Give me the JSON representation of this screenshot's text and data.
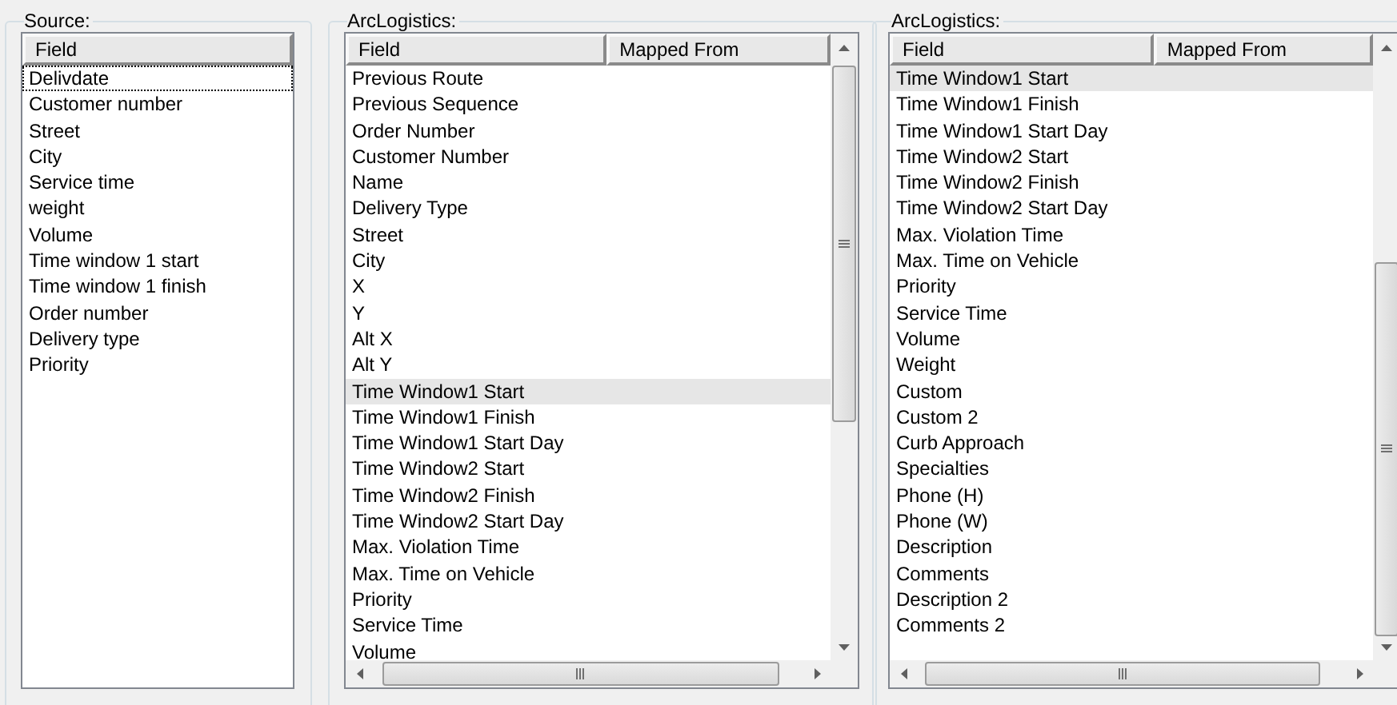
{
  "panels": [
    {
      "title": "Source:",
      "columns": [
        "Field"
      ],
      "scrollbars": false,
      "items": [
        {
          "label": "Delivdate",
          "selected": false,
          "focused": true
        },
        {
          "label": "Customer number",
          "selected": false,
          "focused": false
        },
        {
          "label": "Street",
          "selected": false,
          "focused": false
        },
        {
          "label": "City",
          "selected": false,
          "focused": false
        },
        {
          "label": "Service time",
          "selected": false,
          "focused": false
        },
        {
          "label": "weight",
          "selected": false,
          "focused": false
        },
        {
          "label": "Volume",
          "selected": false,
          "focused": false
        },
        {
          "label": "Time window 1 start",
          "selected": false,
          "focused": false
        },
        {
          "label": "Time window 1 finish",
          "selected": false,
          "focused": false
        },
        {
          "label": "Order number",
          "selected": false,
          "focused": false
        },
        {
          "label": "Delivery type",
          "selected": false,
          "focused": false
        },
        {
          "label": "Priority",
          "selected": false,
          "focused": false
        }
      ]
    },
    {
      "title": "ArcLogistics:",
      "columns": [
        "Field",
        "Mapped From"
      ],
      "scrollbars": true,
      "items": [
        {
          "label": "Previous Route",
          "selected": false
        },
        {
          "label": "Previous Sequence",
          "selected": false
        },
        {
          "label": "Order Number",
          "selected": false
        },
        {
          "label": "Customer Number",
          "selected": false
        },
        {
          "label": "Name",
          "selected": false
        },
        {
          "label": "Delivery Type",
          "selected": false
        },
        {
          "label": "Street",
          "selected": false
        },
        {
          "label": "City",
          "selected": false
        },
        {
          "label": "X",
          "selected": false
        },
        {
          "label": "Y",
          "selected": false
        },
        {
          "label": "Alt X",
          "selected": false
        },
        {
          "label": "Alt Y",
          "selected": false
        },
        {
          "label": "Time Window1 Start",
          "selected": true
        },
        {
          "label": "Time Window1 Finish",
          "selected": false
        },
        {
          "label": "Time Window1 Start Day",
          "selected": false
        },
        {
          "label": "Time Window2 Start",
          "selected": false
        },
        {
          "label": "Time Window2 Finish",
          "selected": false
        },
        {
          "label": "Time Window2 Start Day",
          "selected": false
        },
        {
          "label": "Max. Violation Time",
          "selected": false
        },
        {
          "label": "Max. Time on Vehicle",
          "selected": false
        },
        {
          "label": "Priority",
          "selected": false
        },
        {
          "label": "Service Time",
          "selected": false
        },
        {
          "label": "Volume",
          "selected": false
        }
      ]
    },
    {
      "title": "ArcLogistics:",
      "columns": [
        "Field",
        "Mapped From"
      ],
      "scrollbars": true,
      "items": [
        {
          "label": "Time Window1 Start",
          "selected": true
        },
        {
          "label": "Time Window1 Finish",
          "selected": false
        },
        {
          "label": "Time Window1 Start Day",
          "selected": false
        },
        {
          "label": "Time Window2 Start",
          "selected": false
        },
        {
          "label": "Time Window2 Finish",
          "selected": false
        },
        {
          "label": "Time Window2 Start Day",
          "selected": false
        },
        {
          "label": "Max. Violation Time",
          "selected": false
        },
        {
          "label": "Max. Time on Vehicle",
          "selected": false
        },
        {
          "label": "Priority",
          "selected": false
        },
        {
          "label": "Service Time",
          "selected": false
        },
        {
          "label": "Volume",
          "selected": false
        },
        {
          "label": "Weight",
          "selected": false
        },
        {
          "label": "Custom",
          "selected": false
        },
        {
          "label": "Custom 2",
          "selected": false
        },
        {
          "label": "Curb Approach",
          "selected": false
        },
        {
          "label": "Specialties",
          "selected": false
        },
        {
          "label": "Phone (H)",
          "selected": false
        },
        {
          "label": "Phone (W)",
          "selected": false
        },
        {
          "label": "Description",
          "selected": false
        },
        {
          "label": "Comments",
          "selected": false
        },
        {
          "label": "Description 2",
          "selected": false
        },
        {
          "label": "Comments 2",
          "selected": false
        }
      ]
    }
  ]
}
